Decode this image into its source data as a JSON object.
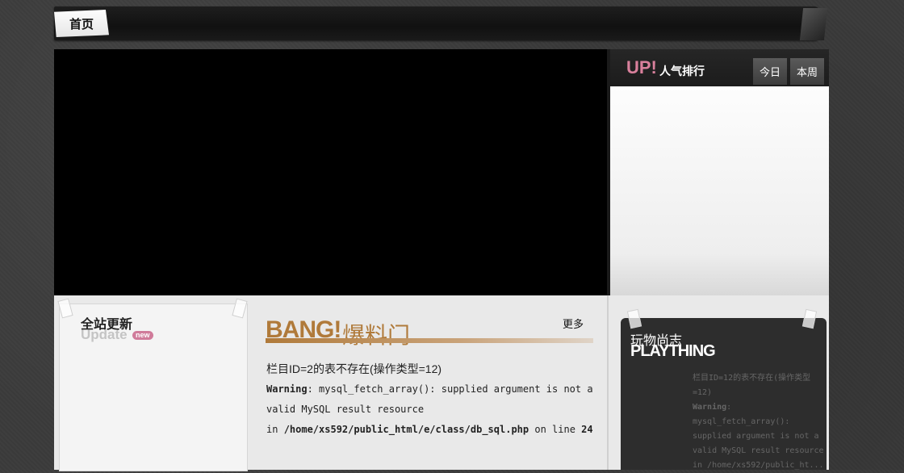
{
  "nav": {
    "home": "首页"
  },
  "rank": {
    "title": "UP!",
    "subtitle": "人气排行",
    "tabs": [
      "今日",
      "本周"
    ]
  },
  "update": {
    "title": "全站更新",
    "subtitle": "Update",
    "badge": "new"
  },
  "bang": {
    "logo": "BANG!",
    "title": "爆料门",
    "more": "更多"
  },
  "bang_error": {
    "message": "栏目ID=2的表不存在(操作类型=12)",
    "warning_label": "Warning",
    "warning_text": ": mysql_fetch_array(): supplied argument is not a valid MySQL result resource",
    "in_text": "in ",
    "path": "/home/xs592/public_html/e/class/db_sql.php",
    "on_line": " on line ",
    "line": "24"
  },
  "plaything": {
    "cn": "玩物尚志",
    "en": "PLAYTHING"
  },
  "plaything_error": {
    "message": "栏目ID=12的表不存在(操作类型=12)",
    "warning_label": "Warning",
    "warning_text": ": mysql_fetch_array(): supplied argument is not a valid MySQL result resource",
    "in_text": "in /home/xs592/public_ht..."
  }
}
